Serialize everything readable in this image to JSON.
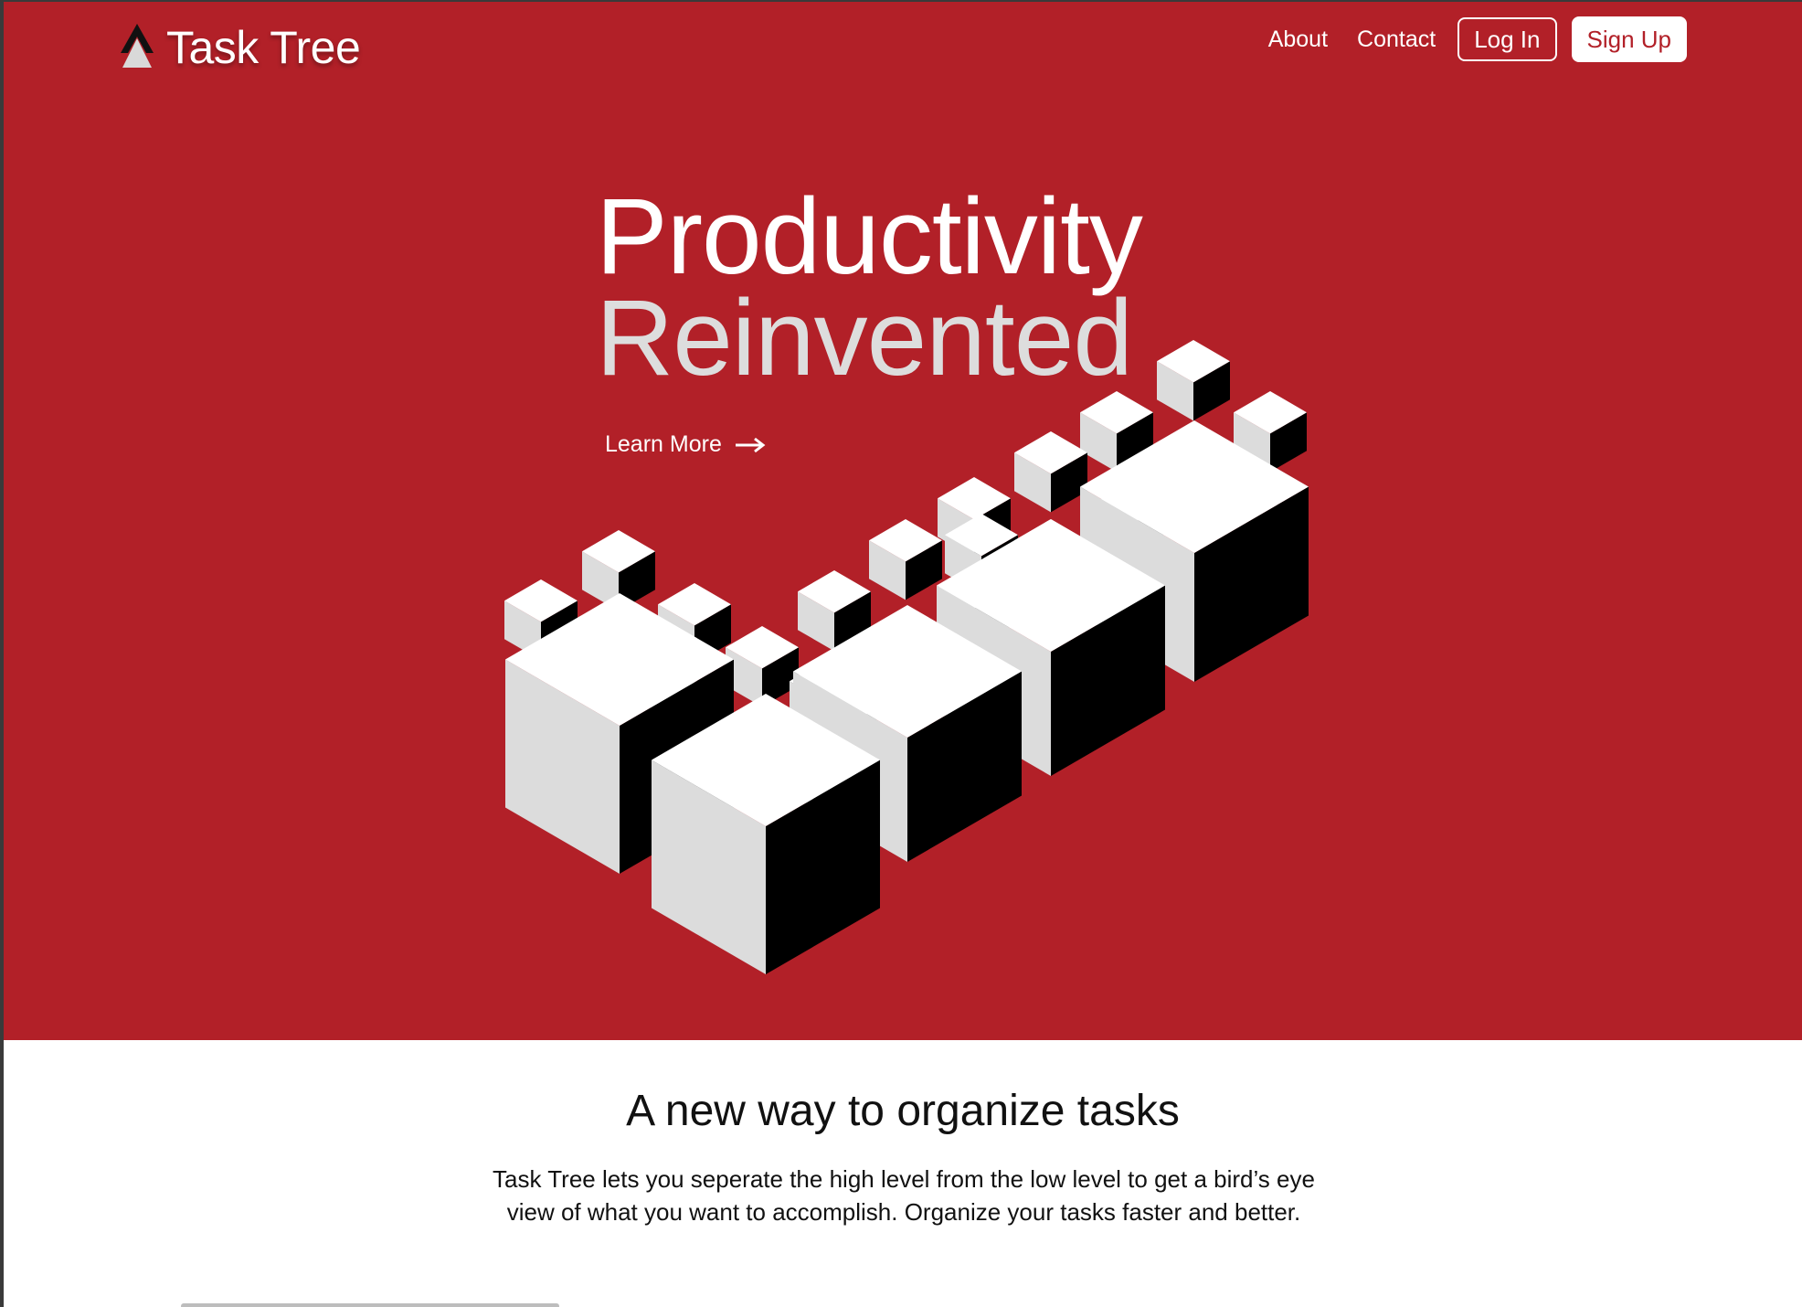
{
  "brand": {
    "name": "Task Tree",
    "logo_icon": "peak-icon"
  },
  "nav": {
    "about": "About",
    "contact": "Contact",
    "login": "Log In",
    "signup": "Sign Up"
  },
  "hero": {
    "line1": "Productivity",
    "line2": "Reinvented",
    "cta": "Learn More",
    "cta_icon": "arrow-right-icon",
    "illustration": "isometric-blocks-icon"
  },
  "section": {
    "title": "A new way to organize tasks",
    "text": "Task Tree lets you seperate the high level from the low level to get a bird’s eye view of what you want to accomplish. Organize your tasks faster and better."
  },
  "colors": {
    "brand_red": "#b22028",
    "white": "#ffffff",
    "light_gray": "#dddddd",
    "black": "#000000"
  }
}
